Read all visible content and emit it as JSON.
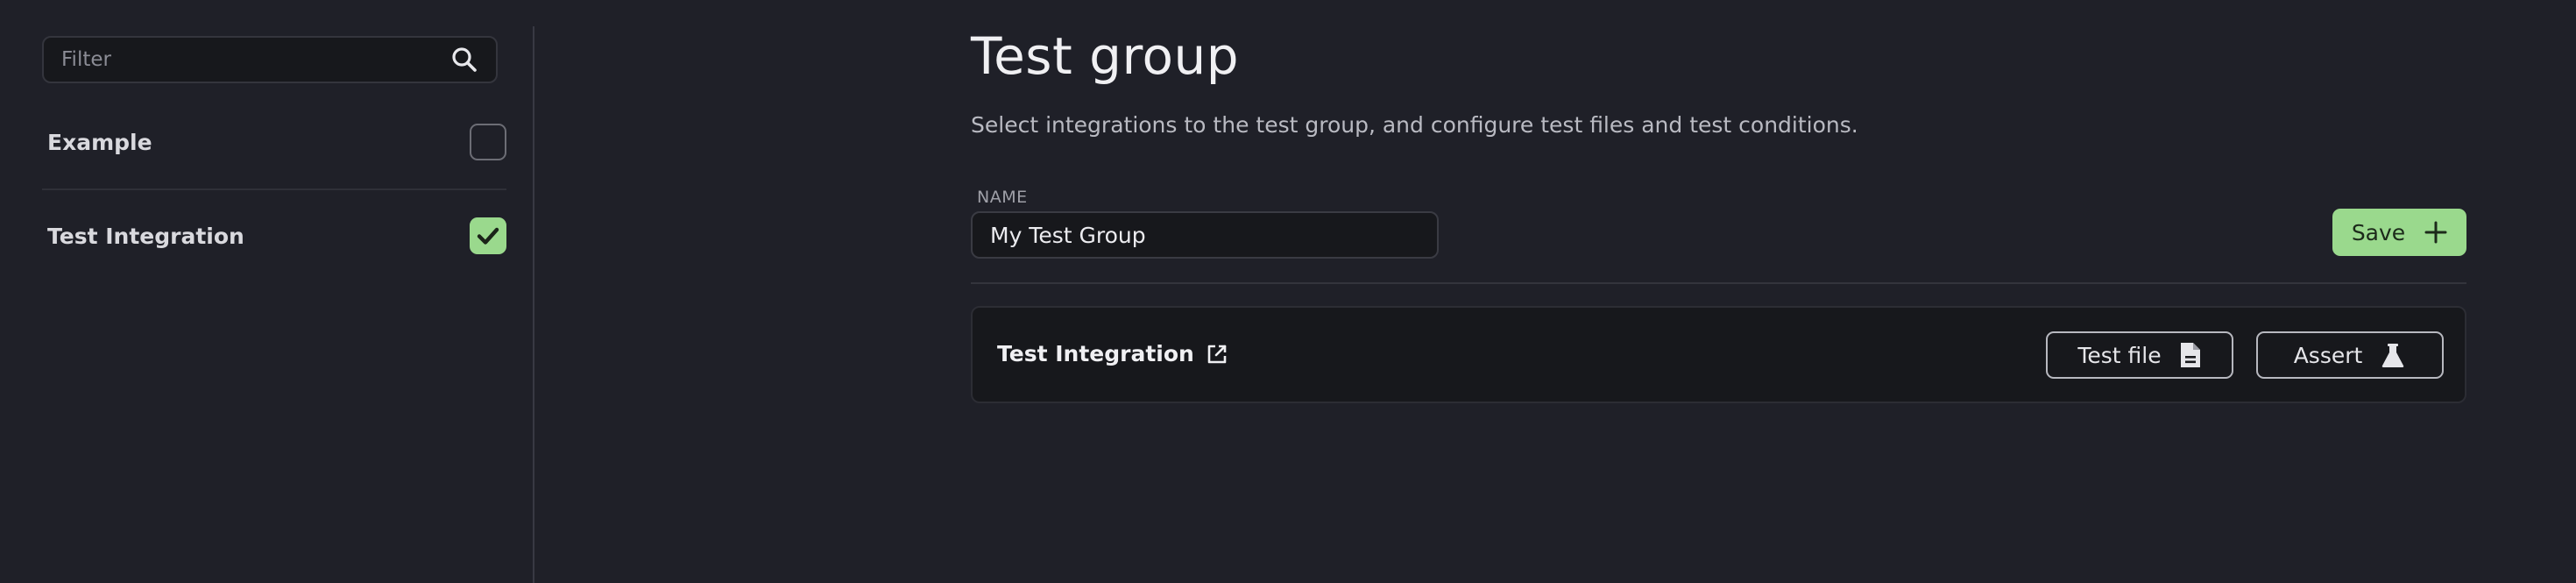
{
  "sidebar": {
    "filter": {
      "placeholder": "Filter",
      "icon": "search-icon"
    },
    "integrations": [
      {
        "label": "Example",
        "checked": false
      },
      {
        "label": "Test Integration",
        "checked": true
      }
    ]
  },
  "main": {
    "title": "Test group",
    "description": "Select integrations to the test group, and configure test files and test conditions.",
    "name_label": "NAME",
    "name_value": "My Test Group",
    "save_label": "Save",
    "card": {
      "title": "Test Integration",
      "test_file_label": "Test file",
      "assert_label": "Assert"
    }
  },
  "colors": {
    "background": "#1f2028",
    "input_background": "#17181c",
    "accent_green": "#9ad98d"
  }
}
